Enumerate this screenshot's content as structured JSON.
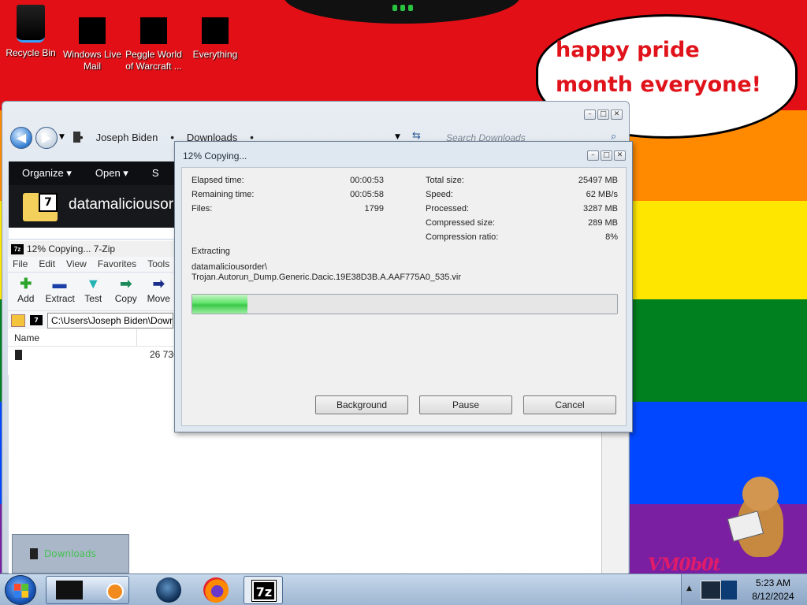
{
  "desktop": {
    "icons": [
      {
        "label": "Recycle Bin",
        "icon": "recycle-bin-icon"
      },
      {
        "label": "Windows Live Mail",
        "icon": "windows-live-mail-icon"
      },
      {
        "label": "Peggle World of Warcraft ...",
        "icon": "peggle-icon"
      },
      {
        "label": "Everything",
        "icon": "everything-icon"
      }
    ],
    "bubble_text": "happy pride month everyone!",
    "watermark": "VM0b0t",
    "colors": {
      "red": "#e21016",
      "orange": "#ff8a00",
      "yellow": "#ffe600",
      "green": "#00801f",
      "blue": "#0047ff",
      "purple": "#7a1fa2"
    }
  },
  "explorer": {
    "breadcrumb": [
      "Joseph Biden",
      "Downloads"
    ],
    "search_placeholder": "Search Downloads",
    "toolbar": {
      "organize": "Organize ▾",
      "open": "Open ▾",
      "share": "S"
    },
    "header_name": "datamaliciousorder",
    "left_tile_label": "Downloads"
  },
  "zip7": {
    "title": "12% Copying... 7-Zip",
    "menu": [
      "File",
      "Edit",
      "View",
      "Favorites",
      "Tools"
    ],
    "tools": [
      {
        "label": "Add",
        "icon": "add-icon",
        "glyph": "✚",
        "color": "#2aa52a"
      },
      {
        "label": "Extract",
        "icon": "extract-icon",
        "glyph": "▬",
        "color": "#1b3fa6"
      },
      {
        "label": "Test",
        "icon": "test-icon",
        "glyph": "▼",
        "color": "#21b3b3"
      },
      {
        "label": "Copy",
        "icon": "copy-icon",
        "glyph": "➡",
        "color": "#1d8a5a"
      },
      {
        "label": "Move",
        "icon": "move-icon",
        "glyph": "➡",
        "color": "#1b2f8a"
      }
    ],
    "address": "C:\\Users\\Joseph Biden\\Downloads",
    "column_name": "Name",
    "row_size": "26 736"
  },
  "dialog": {
    "title": "12% Copying...",
    "left_stats": [
      {
        "label": "Elapsed time:",
        "value": "00:00:53"
      },
      {
        "label": "Remaining time:",
        "value": "00:05:58"
      },
      {
        "label": "Files:",
        "value": "1799"
      }
    ],
    "right_stats": [
      {
        "label": "Total size:",
        "value": "25497 MB"
      },
      {
        "label": "Speed:",
        "value": "62 MB/s"
      },
      {
        "label": "Processed:",
        "value": "3287 MB"
      },
      {
        "label": "Compressed size:",
        "value": "289 MB"
      },
      {
        "label": "Compression ratio:",
        "value": "8%"
      }
    ],
    "status": "Extracting",
    "path_line1": "datamaliciousorder\\",
    "path_line2": "Trojan.Autorun_Dump.Generic.Dacic.19E38D3B.A.AAF775A0_535.vir",
    "progress_fraction": 0.13,
    "buttons": {
      "background": "Background",
      "pause": "Pause",
      "cancel": "Cancel"
    }
  },
  "taskbar": {
    "time": "5:23 AM",
    "date": "8/12/2024",
    "zip_icon_text": "7z"
  }
}
